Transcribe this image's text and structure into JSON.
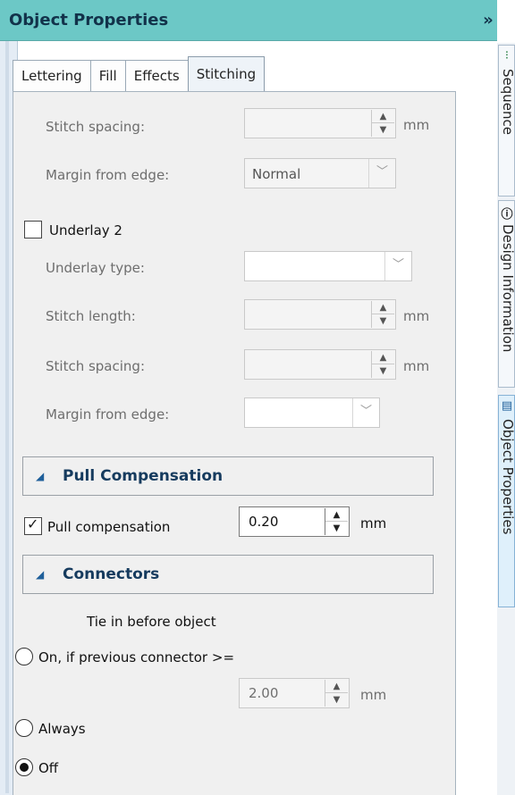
{
  "panel": {
    "title": "Object Properties",
    "collapse_glyph": "»"
  },
  "tabs": [
    {
      "label": "Lettering",
      "active": false
    },
    {
      "label": "Fill",
      "active": false
    },
    {
      "label": "Effects",
      "active": false
    },
    {
      "label": "Stitching",
      "active": true
    }
  ],
  "underlay1": {
    "stitch_spacing": {
      "label": "Stitch spacing:",
      "value": "",
      "unit": "mm"
    },
    "margin_from_edge": {
      "label": "Margin from edge:",
      "value": "Normal"
    }
  },
  "underlay2": {
    "checkbox_label": "Underlay 2",
    "checked": false,
    "underlay_type": {
      "label": "Underlay type:",
      "value": ""
    },
    "stitch_length": {
      "label": "Stitch length:",
      "value": "",
      "unit": "mm"
    },
    "stitch_spacing": {
      "label": "Stitch spacing:",
      "value": "",
      "unit": "mm"
    },
    "margin_from_edge": {
      "label": "Margin from edge:",
      "value": ""
    }
  },
  "pull_compensation": {
    "section_title": "Pull Compensation",
    "checkbox_label": "Pull compensation",
    "checked": true,
    "value": "0.20",
    "unit": "mm"
  },
  "connectors": {
    "section_title": "Connectors",
    "tie_in_label": "Tie in before object",
    "options": [
      {
        "label": "On, if previous connector >=",
        "selected": false
      },
      {
        "label": "Always",
        "selected": false
      },
      {
        "label": "Off",
        "selected": true
      }
    ],
    "connector_value": "2.00",
    "connector_unit": "mm"
  },
  "right_tabs": [
    {
      "label": "Sequence",
      "icon": "sequence-icon",
      "active": false
    },
    {
      "label": "Design Information",
      "icon": "info-icon",
      "active": false
    },
    {
      "label": "Object Properties",
      "icon": "properties-icon",
      "active": true
    }
  ],
  "colors": {
    "titlebar": "#6cc8c6",
    "section_title": "#163b5e",
    "active_right_tab": "#dff0fb"
  }
}
